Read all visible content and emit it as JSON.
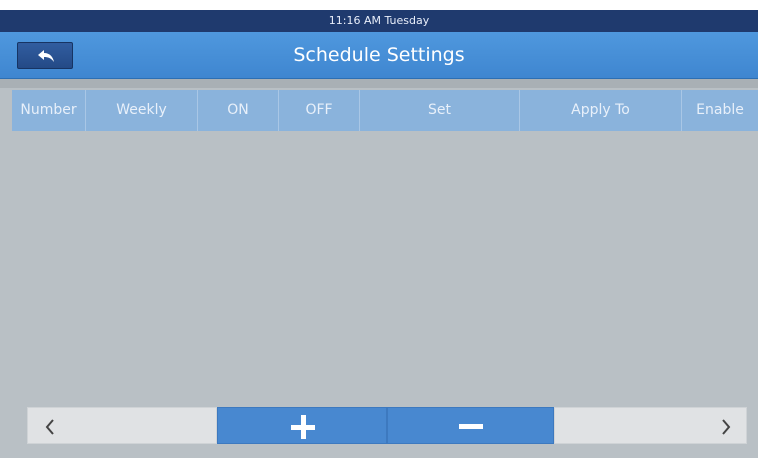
{
  "status_bar": {
    "time": "11:16 AM",
    "day": "Tuesday"
  },
  "header": {
    "title": "Schedule Settings",
    "back_icon": "back-arrow-icon"
  },
  "table": {
    "columns": [
      "Number",
      "Weekly",
      "ON",
      "OFF",
      "Set",
      "Apply To",
      "Enable"
    ],
    "rows": []
  },
  "colors": {
    "status_bar": "#1f3a6e",
    "title_bar": "#4a93da",
    "table_header": "#8ab3dc",
    "background": "#b9c0c5",
    "button_blue": "#4888d0"
  },
  "icons": {
    "prev": "chevron-left-icon",
    "add": "plus-icon",
    "remove": "minus-icon",
    "next": "chevron-right-icon"
  }
}
